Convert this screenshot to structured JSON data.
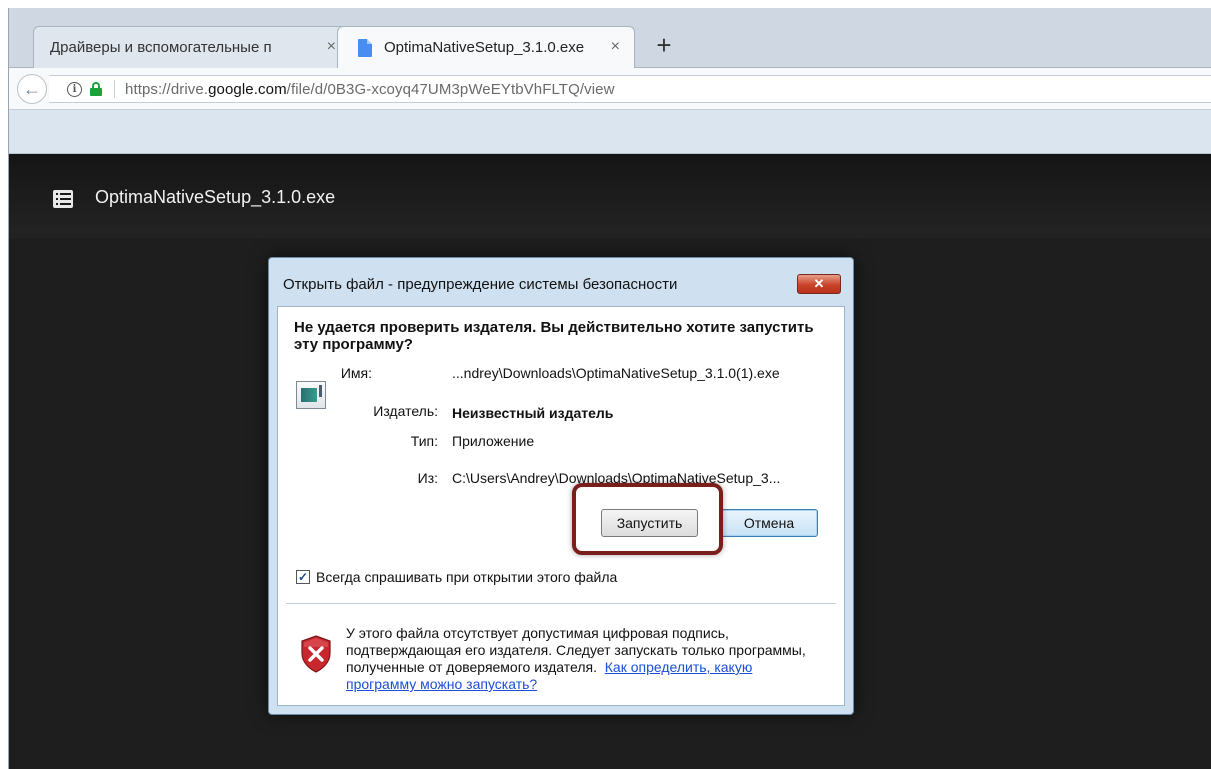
{
  "browser": {
    "tabs": [
      {
        "title": "Драйверы и вспомогательные п",
        "active": false,
        "close": "×"
      },
      {
        "title": "OptimaNativeSetup_3.1.0.exe",
        "active": true,
        "close": "×"
      }
    ],
    "new_tab": "+",
    "nav": {
      "back": "←"
    },
    "url": {
      "prefix": "https://drive.",
      "domain": "google.com",
      "path": "/file/d/0B3G-xcoyq47UM3pWeEYtbVhFLTQ/view"
    },
    "info_icon": "i"
  },
  "viewer": {
    "file_name": "OptimaNativeSetup_3.1.0.exe"
  },
  "dialog": {
    "title": "Открыть файл - предупреждение системы безопасности",
    "close": "✕",
    "question": "Не удается проверить издателя.  Вы действительно хотите запустить эту программу?",
    "fields": {
      "name_label": "Имя:",
      "name_value": "...ndrey\\Downloads\\OptimaNativeSetup_3.1.0(1).exe",
      "publisher_label": "Издатель:",
      "publisher_value": "Неизвестный издатель",
      "type_label": "Тип:",
      "type_value": "Приложение",
      "from_label": "Из:",
      "from_value": "C:\\Users\\Andrey\\Downloads\\OptimaNativeSetup_3..."
    },
    "run_button": "Запустить",
    "cancel_button": "Отмена",
    "checkbox": {
      "label": "Всегда спрашивать при открытии этого файла",
      "checked": true,
      "mark": "✓"
    },
    "warning_text": "У этого файла отсутствует допустимая цифровая подпись, подтверждающая его издателя.  Следует запускать только программы, полученные от доверяемого издателя.",
    "warning_link": "Как определить, какую программу можно запускать?"
  },
  "colors": {
    "highlight": "#7a1e1c",
    "shield": "#c8272e",
    "link": "#1a4fd6"
  }
}
